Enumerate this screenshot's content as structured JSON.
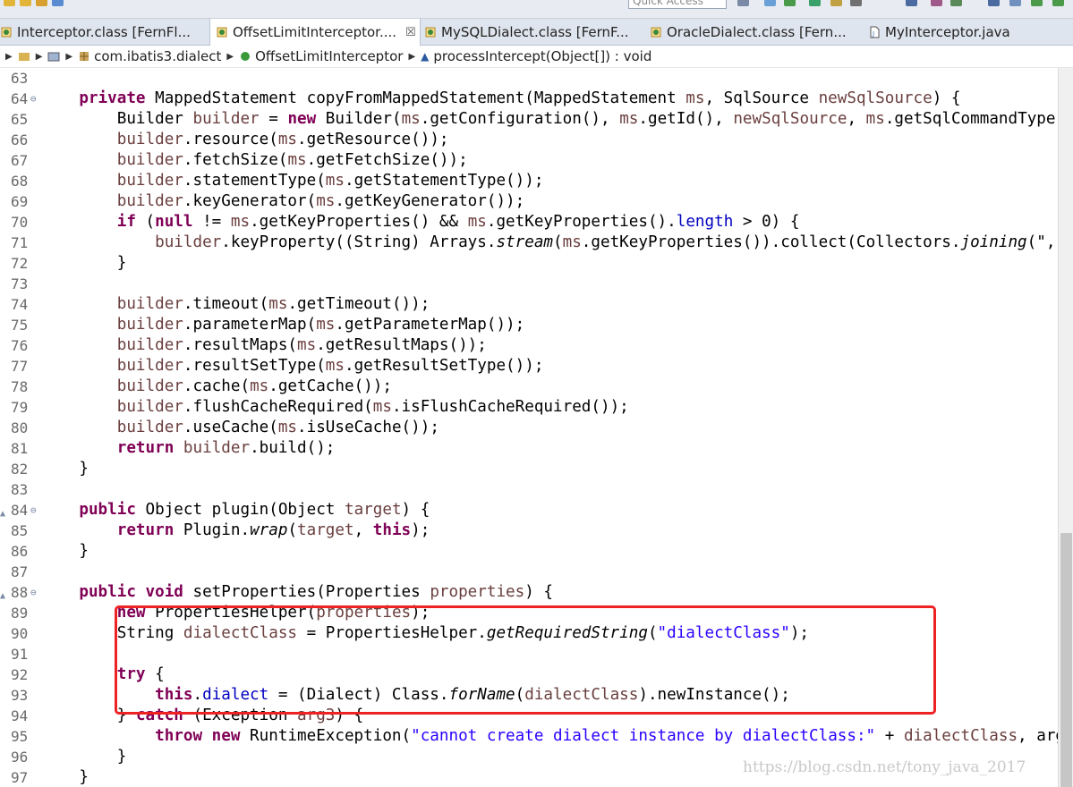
{
  "toolbar": {
    "quick_access": "Quick Access"
  },
  "tabs": [
    {
      "label": "Interceptor.class [FernFl...",
      "icon": "class-file-icon"
    },
    {
      "label": "OffsetLimitInterceptor....",
      "icon": "class-file-icon",
      "close": "☒"
    },
    {
      "label": "MySQLDialect.class [FernF...",
      "icon": "class-file-icon"
    },
    {
      "label": "OracleDialect.class [Fern...",
      "icon": "class-file-icon"
    },
    {
      "label": "MyInterceptor.java",
      "icon": "java-file-icon"
    }
  ],
  "breadcrumb": {
    "package": "com.ibatis3.dialect",
    "class": "OffsetLimitInterceptor",
    "method": "processIntercept(Object[]) : void"
  },
  "editor": {
    "line_numbers": [
      "63",
      "64",
      "65",
      "66",
      "67",
      "68",
      "69",
      "70",
      "71",
      "72",
      "73",
      "74",
      "75",
      "76",
      "77",
      "78",
      "79",
      "80",
      "81",
      "82",
      "83",
      "84",
      "85",
      "86",
      "87",
      "88",
      "89",
      "90",
      "91",
      "92",
      "93",
      "94",
      "95",
      "96",
      "97"
    ],
    "markers": {
      "84": "▲",
      "88": "▲"
    },
    "folds": {
      "64": "⊖",
      "84": "⊖",
      "88": "⊖"
    }
  },
  "watermark": "https://blog.csdn.net/tony_java_2017",
  "colors": {
    "keyword": "#7f0055",
    "variable": "#6a3e3e",
    "field": "#0000c0",
    "string": "#2a00ff",
    "highlight": "#ee2222"
  }
}
